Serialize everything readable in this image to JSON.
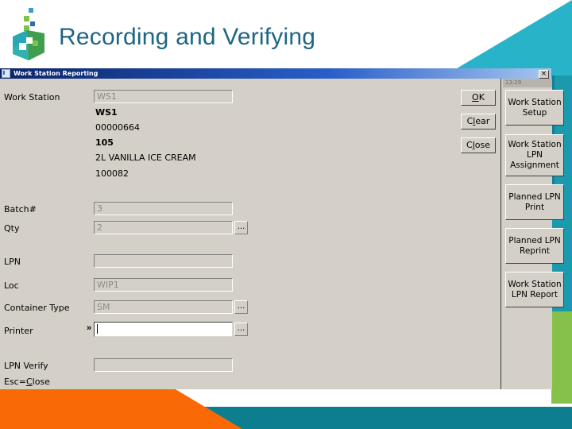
{
  "slide": {
    "title": "Recording and Verifying",
    "title_color": "#1f6584",
    "logo_name": "company-cube-logo"
  },
  "window": {
    "title": "Work Station Reporting",
    "close_glyph": "×",
    "status_time": "13:29",
    "footer_hint_prefix": "Esc=",
    "footer_hint_key": "C",
    "footer_hint_rest": "lose"
  },
  "buttons": {
    "ok": {
      "pre": "",
      "key": "O",
      "post": "K"
    },
    "clear": {
      "pre": "C",
      "key": "l",
      "post": "ear"
    },
    "close": {
      "pre": "C",
      "key": "l",
      "post": "ose"
    }
  },
  "form": {
    "fields": [
      {
        "label": "Work Station",
        "value": "WS1",
        "state": "readonly",
        "browse": false
      },
      {
        "label": "Batch#",
        "value": "3",
        "state": "readonly",
        "browse": false
      },
      {
        "label": "Qty",
        "value": "2",
        "state": "readonly",
        "browse": true
      },
      {
        "label": "LPN",
        "value": "",
        "state": "readonly",
        "browse": false
      },
      {
        "label": "Loc",
        "value": "WIP1",
        "state": "readonly",
        "browse": false
      },
      {
        "label": "Container Type",
        "value": "SM",
        "state": "readonly",
        "browse": true
      },
      {
        "label": "Printer",
        "value": "",
        "state": "active",
        "browse": true
      },
      {
        "label": "LPN Verify",
        "value": "",
        "state": "readonly",
        "browse": false
      }
    ],
    "info_lines": [
      {
        "text": "WS1",
        "bold": true
      },
      {
        "text": "00000664",
        "bold": false
      },
      {
        "text": "105",
        "bold": true
      },
      {
        "text": "2L VANILLA ICE CREAM",
        "bold": false
      },
      {
        "text": "100082",
        "bold": false
      }
    ],
    "browse_label": "...",
    "focus_marker": "»"
  },
  "side_panel": {
    "buttons": [
      {
        "lines": [
          "Work Station",
          "Setup"
        ]
      },
      {
        "lines": [
          "Work Station",
          "LPN",
          "Assignment"
        ]
      },
      {
        "lines": [
          "Planned LPN",
          "Print"
        ]
      },
      {
        "lines": [
          "Planned LPN",
          "Reprint"
        ]
      },
      {
        "lines": [
          "Work Station",
          "LPN Report"
        ]
      }
    ]
  },
  "colors": {
    "teal": "#29b3c8",
    "teal_dark": "#0d7e8f",
    "orange": "#f96a07",
    "green": "#86c24a",
    "dialog_face": "#d4d0c8"
  }
}
